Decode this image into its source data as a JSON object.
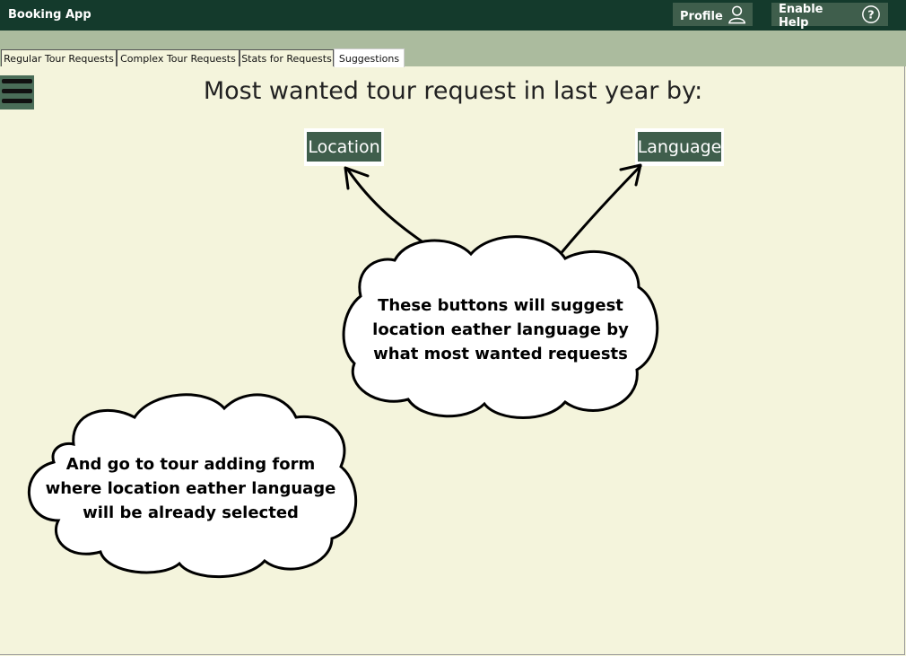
{
  "app": {
    "title": "Booking App"
  },
  "header": {
    "profile_label": "Profile",
    "profile_icon": "user-icon",
    "help_label": "Enable Help",
    "help_icon": "question-circle-icon"
  },
  "tabs": [
    {
      "label": "Regular Tour Requests",
      "active": false
    },
    {
      "label": "Complex Tour Requests",
      "active": false
    },
    {
      "label": "Stats for Requests",
      "active": false
    },
    {
      "label": "Suggestions",
      "active": true
    }
  ],
  "menu": {
    "icon": "hamburger-menu-icon"
  },
  "main": {
    "heading": "Most wanted tour request in last year by:",
    "location_button": "Location",
    "language_button": "Language"
  },
  "annotations": {
    "cloud1": [
      "These buttons will suggest",
      "location eather language by",
      "what most wanted requests"
    ],
    "cloud2": [
      "And go to tour adding form",
      "where location eather  language",
      "will be already selected"
    ]
  },
  "colors": {
    "titlebar": "#143a2c",
    "tabstrip": "#abbb9e",
    "background": "#f4f4dc",
    "button": "#3f5e4c"
  }
}
